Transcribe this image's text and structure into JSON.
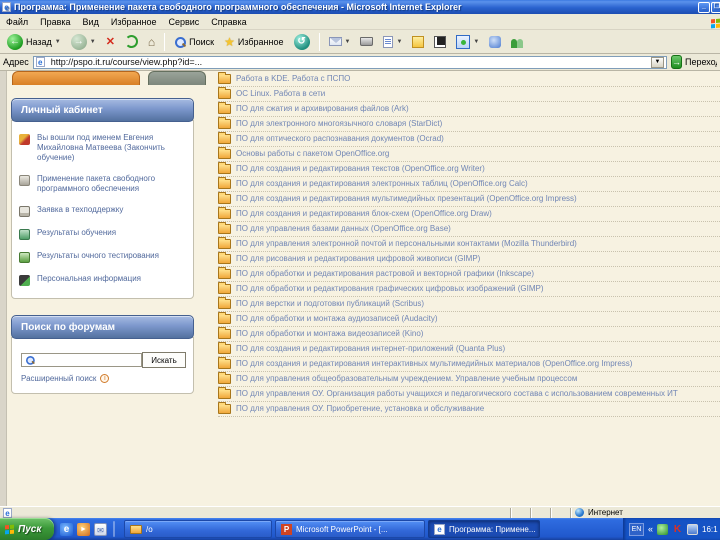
{
  "window": {
    "title": "Программа: Применение пакета свободного программного обеспечения - Microsoft Internet Explorer",
    "minimize_glyph": "_",
    "maximize_glyph": "❐"
  },
  "menu": {
    "items": [
      "Файл",
      "Правка",
      "Вид",
      "Избранное",
      "Сервис",
      "Справка"
    ]
  },
  "toolbar": {
    "back_label": "Назад",
    "search_label": "Поиск",
    "favorites_label": "Избранное"
  },
  "address": {
    "label": "Адрес",
    "url": "http://pspo.it.ru/course/view.php?id=...",
    "go_label": "Переход"
  },
  "sidebar": {
    "personal": {
      "title": "Личный кабинет",
      "items": [
        {
          "icon": "user-login-icon",
          "text": "Вы вошли под именем Евгения Михайловна Матвеева (Закончить обучение)"
        },
        {
          "icon": "course-icon",
          "text": "Применение пакета свободного программного обеспечения"
        },
        {
          "icon": "support-icon",
          "text": "Заявка в техподдержку"
        },
        {
          "icon": "results-icon",
          "text": "Результаты обучения"
        },
        {
          "icon": "testing-icon",
          "text": "Результаты очного тестирования"
        },
        {
          "icon": "profile-icon",
          "text": "Персональная информация"
        }
      ]
    },
    "forum_search": {
      "title": "Поиск по форумам",
      "input_value": "",
      "button_label": "Искать",
      "advanced_label": "Расширенный поиск",
      "info_glyph": "i"
    }
  },
  "courses": [
    "Работа в KDE. Работа с ПСПО",
    "ОС Linux. Работа в сети",
    "ПО для сжатия и архивирования файлов (Ark)",
    "ПО для электронного многоязычного словаря (StarDict)",
    "ПО для оптического распознавания документов (Ocrad)",
    "Основы работы с пакетом OpenOffice.org",
    "ПО для создания и редактирования текстов (OpenOffice.org Writer)",
    "ПО для создания и редактирования электронных таблиц (OpenOffice.org Calc)",
    "ПО для создания и редактирования мультимедийных презентаций (OpenOffice.org Impress)",
    "ПО для создания и редактирования блок-схем (OpenOffice.org Draw)",
    "ПО для управления базами данных (OpenOffice.org Base)",
    "ПО для управления электронной почтой и персональными контактами (Mozilla Thunderbird)",
    "ПО для рисования и редактирования цифровой живописи (GIMP)",
    "ПО для обработки и редактирования растровой и векторной графики (Inkscape)",
    "ПО для обработки и редактирования графических цифровых изображений (GIMP)",
    "ПО для верстки и подготовки публикаций (Scribus)",
    "ПО для обработки и монтажа аудиозаписей (Audacity)",
    "ПО для обработки и монтажа видеозаписей (Kino)",
    "ПО для создания и редактирования интернет-приложений (Quanta Plus)",
    "ПО для создания и редактирования интерактивных мультимедийных материалов (OpenOffice.org Impress)",
    "ПО для управления общеобразовательным учреждением. Управление учебным процессом",
    "ПО для управления ОУ. Организация работы учащихся и педагогического состава с использованием современных ИТ",
    "ПО для управления ОУ. Приобретение, установка и обслуживание"
  ],
  "status": {
    "zone_label": "Интернет"
  },
  "taskbar": {
    "start_label": "Пуск",
    "tasks": [
      {
        "icon": "folder",
        "label": "/о",
        "active": false
      },
      {
        "icon": "powerpoint",
        "label": "Microsoft PowerPoint - [...",
        "active": false
      },
      {
        "icon": "ie",
        "label": "Программа: Примене...",
        "active": true
      }
    ],
    "tray": {
      "lang": "EN",
      "chevron": "«",
      "time": "16:1"
    }
  },
  "icons": {
    "powerpoint_glyph": "P",
    "ie_glyph": "e",
    "mail_glyph": "✉",
    "media_glyph": "►"
  }
}
